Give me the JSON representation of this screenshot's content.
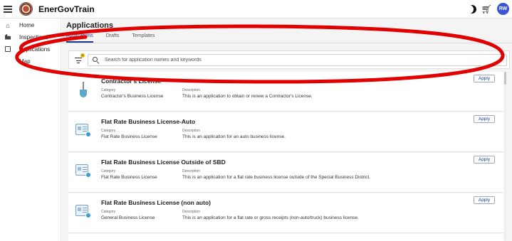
{
  "app": {
    "title": "EnerGovTrain",
    "avatar_initials": "RW",
    "icons": [
      "hamburger-menu-icon",
      "city-seal-logo",
      "dark-mode-icon",
      "cart-icon"
    ]
  },
  "sidebar": {
    "items": [
      {
        "label": "Home",
        "icon": "home-icon"
      },
      {
        "label": "Inspections",
        "icon": "building-icon"
      },
      {
        "label": "Applications",
        "icon": "form-icon"
      },
      {
        "label": "Map",
        "icon": "map-icon"
      }
    ]
  },
  "main": {
    "title": "Applications",
    "tabs": [
      {
        "label": "Applications",
        "active": true
      },
      {
        "label": "Drafts",
        "active": false
      },
      {
        "label": "Templates",
        "active": false
      }
    ],
    "filter_badge": "0",
    "search": {
      "placeholder": "Search for application names and keywords",
      "value": ""
    },
    "category_label": "Category",
    "description_label": "Description",
    "apply_label": "Apply",
    "applications": [
      {
        "name": "Contractor's License",
        "category": "Contractor's Business License",
        "description": "This is an application to obtain or renew a Contractor's License.",
        "icon": "shovel-icon"
      },
      {
        "name": "Flat Rate Business License-Auto",
        "category": "Flat Rate Business License",
        "description": "This is an application for an auto business license.",
        "icon": "document-check-icon"
      },
      {
        "name": "Flat Rate Business License Outside of SBD",
        "category": "Flat Rate Business License",
        "description": "This is an application for a flat rate business license outside of the Special Business District.",
        "icon": "document-check-icon"
      },
      {
        "name": "Flat Rate Business License (non auto)",
        "category": "General Business License",
        "description": "This is an application for a flat rate or gross receipts (non-auto/truck) business license.",
        "icon": "document-check-icon"
      }
    ]
  },
  "colors": {
    "accent": "#1a3c8a",
    "avatar": "#3a56d4",
    "annotation": "#e00000",
    "badge": "#e6b800"
  }
}
